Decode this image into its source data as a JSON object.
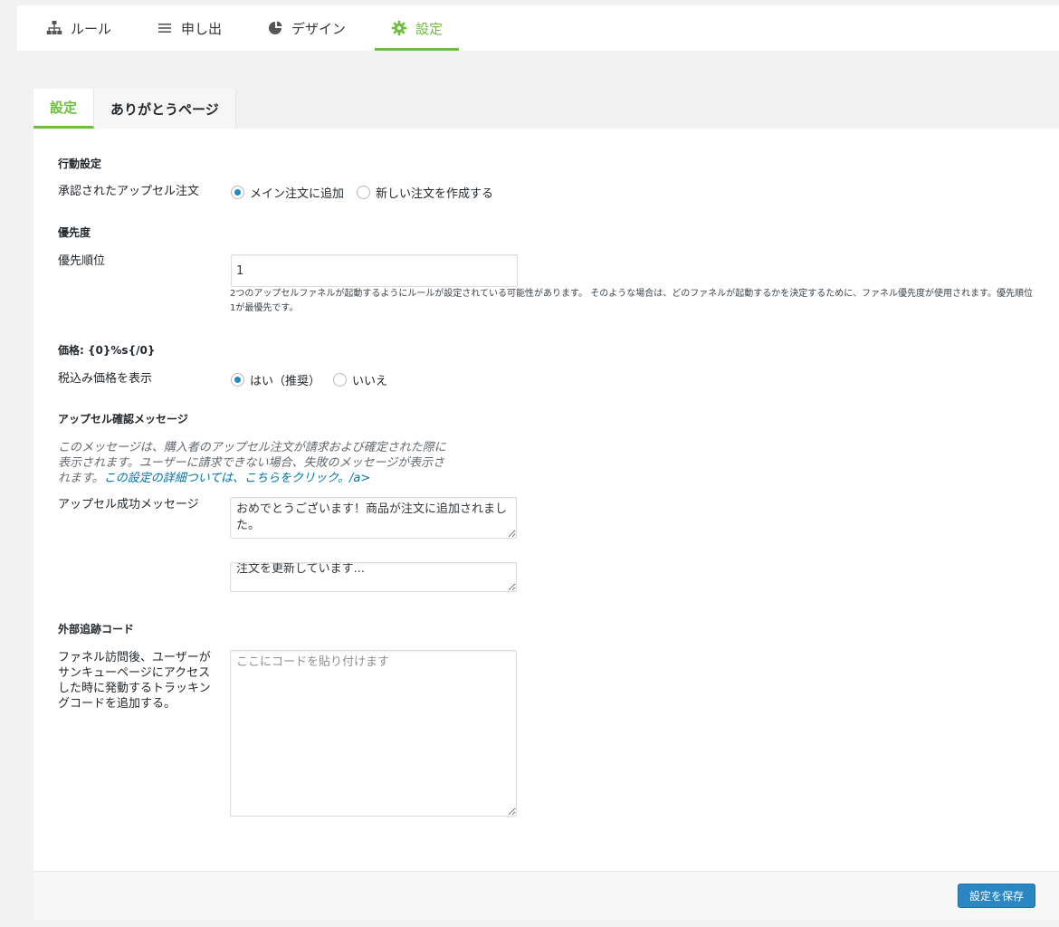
{
  "nav": {
    "items": [
      {
        "label": "ルール",
        "icon": "sitemap-icon"
      },
      {
        "label": "申し出",
        "icon": "list-icon"
      },
      {
        "label": "デザイン",
        "icon": "palette-icon"
      },
      {
        "label": "設定",
        "icon": "gear-icon",
        "active": true
      }
    ],
    "accent_color": "#6cbf3d"
  },
  "subtabs": [
    {
      "label": "設定",
      "active": true
    },
    {
      "label": "ありがとうページ",
      "active": false
    }
  ],
  "behavior": {
    "section_title": "行動設定",
    "upsell_label": "承認されたアップセル注文",
    "options": [
      "メイン注文に追加",
      "新しい注文を作成する"
    ],
    "selected_index": 0
  },
  "priority": {
    "section_title": "優先度",
    "label": "優先順位",
    "value": "1",
    "help": "2つのアップセルファネルが起動するようにルールが設定されている可能性があります。 そのような場合は、どのファネルが起動するかを決定するために、ファネル優先度が使用されます。優先順位1が最優先です。"
  },
  "price": {
    "section_title": "価格: {0}%s{/0}",
    "label": "税込み価格を表示",
    "options": [
      "はい（推奨）",
      "いいえ"
    ],
    "selected_index": 0
  },
  "message": {
    "section_title": "アップセル確認メッセージ",
    "description": "このメッセージは、購入者のアップセル注文が請求および確定された際に表示されます。ユーザーに請求できない場合、失敗のメッセージが表示されます。",
    "link_text": "この設定の詳細ついては、こちらをクリック。/a>",
    "success_label": "アップセル成功メッセージ",
    "success_value": "おめでとうございます！商品が注文に追加されました。",
    "updating_value": "注文を更新しています..."
  },
  "tracking": {
    "section_title": "外部追跡コード",
    "label": "ファネル訪問後、ユーザーがサンキューページにアクセスした時に発動するトラッキングコードを追加する。",
    "placeholder": "ここにコードを貼り付けます"
  },
  "footer": {
    "save_label": "設定を保存",
    "button_color": "#2b86c4"
  }
}
